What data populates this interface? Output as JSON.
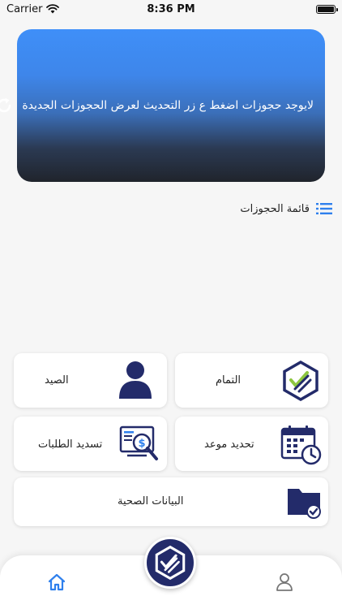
{
  "status_bar": {
    "carrier": "Carrier",
    "time": "8:36 PM"
  },
  "banner": {
    "message": "لايوجد حجوزات اضغط ع زر التحديث لعرض الحجوزات الجديدة",
    "gradient_top": "#3f8ff8",
    "gradient_bottom": "#20242c"
  },
  "bookings": {
    "title": "قائمة الحجوزات"
  },
  "cards": {
    "completion": {
      "label": "التمام"
    },
    "fishing": {
      "label": "الصيد"
    },
    "appointment": {
      "label": "تحديد موعد"
    },
    "payments": {
      "label": "تسديد الطلبات"
    },
    "health": {
      "label": "البيانات الصحية"
    }
  },
  "colors": {
    "navy": "#232b6a",
    "accent_blue": "#2f80ed",
    "background": "#f6f6f6"
  },
  "bottom_nav": {
    "home_icon": "home-icon",
    "profile_icon": "user-icon",
    "center_icon": "app-logo-icon"
  }
}
